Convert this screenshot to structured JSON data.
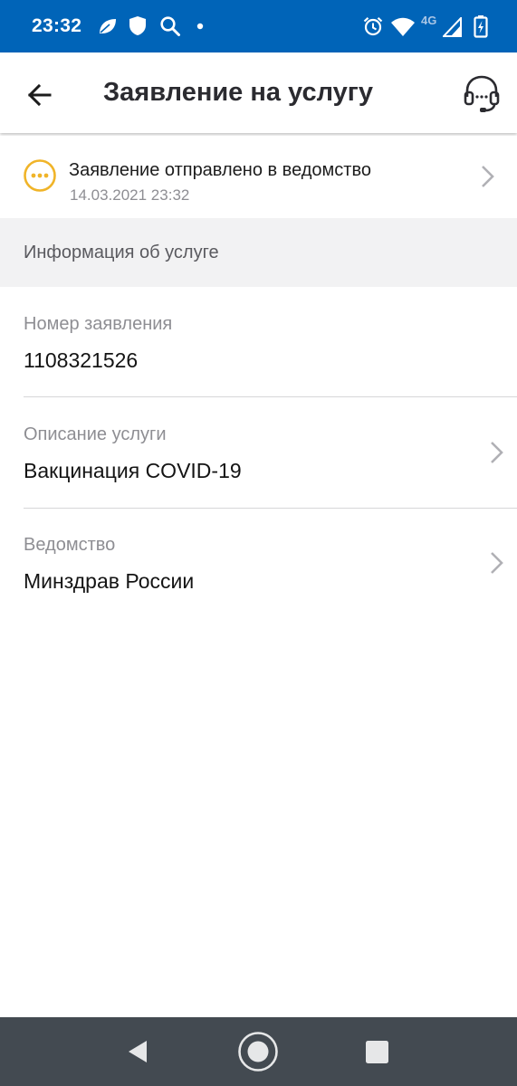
{
  "status_bar": {
    "time": "23:32",
    "network_label": "4G",
    "icons": [
      "leaf-icon",
      "shield-icon",
      "search-icon",
      "dot-icon",
      "alarm-icon",
      "wifi-icon",
      "signal-icon",
      "battery-charging-icon"
    ]
  },
  "app_bar": {
    "title": "Заявление на услугу",
    "back_icon": "arrow-left-icon",
    "support_icon": "headset-icon"
  },
  "application_status": {
    "text": "Заявление отправлено в ведомство",
    "date": "14.03.2021 23:32",
    "icon": "pending-dots-icon",
    "accent": "#f0b429"
  },
  "section": {
    "title": "Информация об услуге"
  },
  "fields": [
    {
      "label": "Номер заявления",
      "value": "1108321526"
    },
    {
      "label": "Описание услуги",
      "value": "Вакцинация COVID-19"
    },
    {
      "label": "Ведомство",
      "value": "Минздрав России"
    }
  ],
  "nav_bar": {
    "icons": [
      "nav-back-icon",
      "nav-home-icon",
      "nav-recents-icon"
    ]
  },
  "colors": {
    "status_bar": "#0064b8",
    "nav_bar": "#434a51",
    "section_background": "#f2f2f3"
  }
}
